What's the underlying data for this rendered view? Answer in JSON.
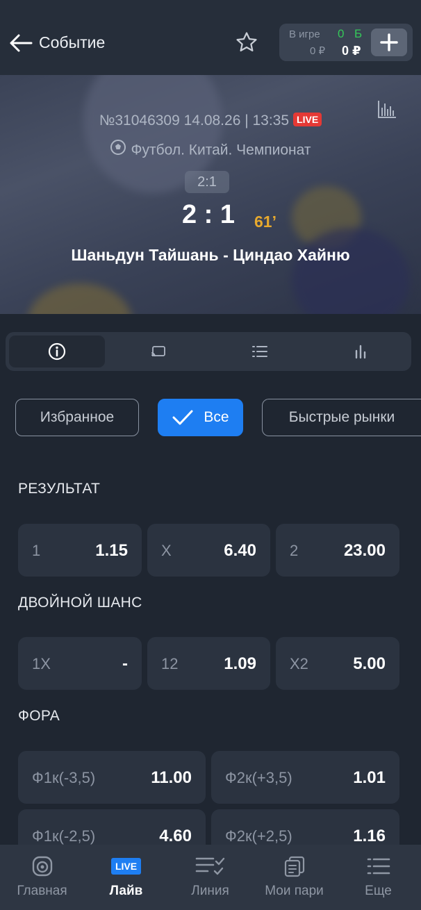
{
  "header": {
    "title": "Событие",
    "balance": {
      "in_game_label": "В игре",
      "in_game_value": "0 ₽",
      "bonus_value": "0",
      "bonus_letter": "Б",
      "main_value": "0 ₽"
    }
  },
  "event": {
    "number_date": "№31046309 14.08.26 | 13:35",
    "live_badge": "LIVE",
    "league": "Футбол. Китай. Чемпионат",
    "half_score": "2:1",
    "score": "2 : 1",
    "minute": "61’",
    "teams": "Шаньдун Тайшань - Циндао Хайню"
  },
  "tabs": [
    {
      "icon": "info-icon"
    },
    {
      "icon": "broadcast-icon"
    },
    {
      "icon": "list-icon"
    },
    {
      "icon": "stats-icon"
    }
  ],
  "filters": {
    "favorites": "Избранное",
    "all": "Все",
    "quick": "Быстрые рынки"
  },
  "markets": {
    "result": {
      "title": "РЕЗУЛЬТАТ",
      "odds": [
        {
          "label": "1",
          "value": "1.15"
        },
        {
          "label": "X",
          "value": "6.40"
        },
        {
          "label": "2",
          "value": "23.00"
        }
      ]
    },
    "double_chance": {
      "title": "ДВОЙНОЙ ШАНС",
      "odds": [
        {
          "label": "1X",
          "value": "-"
        },
        {
          "label": "12",
          "value": "1.09"
        },
        {
          "label": "X2",
          "value": "5.00"
        }
      ]
    },
    "handicap": {
      "title": "ФОРА",
      "odds": [
        {
          "label": "Ф1к(-3,5)",
          "value": "11.00"
        },
        {
          "label": "Ф2к(+3,5)",
          "value": "1.01"
        },
        {
          "label": "Ф1к(-2,5)",
          "value": "4.60"
        },
        {
          "label": "Ф2к(+2,5)",
          "value": "1.16"
        }
      ]
    }
  },
  "bottom_nav": {
    "live_badge": "LIVE",
    "items": [
      {
        "label": "Главная"
      },
      {
        "label": "Лайв"
      },
      {
        "label": "Линия"
      },
      {
        "label": "Мои пари"
      },
      {
        "label": "Еще"
      }
    ]
  },
  "colors": {
    "accent": "#1e7ef2",
    "live": "#e53935",
    "minute": "#e7a92e",
    "bonus": "#35c759"
  }
}
